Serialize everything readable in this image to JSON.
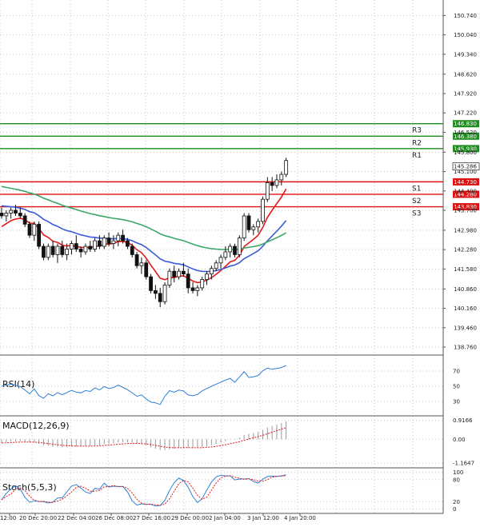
{
  "chart_data": [
    {
      "type": "candlestick",
      "title": "",
      "price_axis": {
        "ylim": [
          138.5,
          151.3
        ],
        "ticks": [
          "150.740",
          "150.040",
          "149.340",
          "148.620",
          "147.920",
          "147.220",
          "146.520",
          "145.800",
          "145.100",
          "144.400",
          "143.700",
          "142.980",
          "142.280",
          "141.580",
          "140.860",
          "140.160",
          "139.460",
          "138.760"
        ]
      },
      "time_axis": {
        "labels": [
          "12:00",
          "20 Dec 20:00",
          "22 Dec 04:00",
          "26 Dec 08:00",
          "27 Dec 16:00",
          "29 Dec 00:00",
          "2 Jan 04:00",
          "3 Jan 12:00",
          "4 Jan 20:00"
        ]
      },
      "current_price": {
        "label": "145.286",
        "value": 145.286
      },
      "levels": [
        {
          "name": "R3",
          "label": "146.830",
          "value": 146.83,
          "color": "#1e8c1e"
        },
        {
          "name": "R2",
          "label": "146.380",
          "value": 146.38,
          "color": "#1e8c1e"
        },
        {
          "name": "R1",
          "label": "145.930",
          "value": 145.93,
          "color": "#1e8c1e"
        },
        {
          "name": "S1",
          "label": "144.730",
          "value": 144.73,
          "color": "#dd1111"
        },
        {
          "name": "S2",
          "label": "144.280",
          "value": 144.28,
          "color": "#dd1111"
        },
        {
          "name": "S3",
          "label": "143.830",
          "value": 143.83,
          "color": "#dd1111"
        }
      ],
      "candles": [
        [
          143.6,
          143.8,
          143.4,
          143.5
        ],
        [
          143.5,
          143.7,
          143.3,
          143.6
        ],
        [
          143.6,
          143.8,
          143.4,
          143.7
        ],
        [
          143.7,
          143.9,
          143.5,
          143.6
        ],
        [
          143.6,
          143.8,
          143.4,
          143.5
        ],
        [
          143.5,
          143.6,
          143.1,
          143.2
        ],
        [
          143.2,
          143.3,
          142.7,
          142.8
        ],
        [
          142.8,
          143.3,
          142.6,
          143.2
        ],
        [
          143.2,
          143.3,
          142.3,
          142.4
        ],
        [
          142.4,
          142.5,
          141.9,
          142.0
        ],
        [
          142.0,
          142.5,
          141.9,
          142.4
        ],
        [
          142.4,
          142.6,
          142.0,
          142.1
        ],
        [
          142.1,
          142.5,
          141.8,
          142.4
        ],
        [
          142.4,
          142.6,
          142.0,
          142.1
        ],
        [
          142.1,
          142.5,
          141.9,
          142.3
        ],
        [
          142.3,
          142.6,
          142.1,
          142.5
        ],
        [
          142.5,
          142.8,
          142.2,
          142.3
        ],
        [
          142.3,
          142.4,
          142.0,
          142.2
        ],
        [
          142.2,
          142.5,
          142.1,
          142.4
        ],
        [
          142.4,
          142.6,
          142.2,
          142.3
        ],
        [
          142.3,
          142.7,
          142.2,
          142.6
        ],
        [
          142.6,
          142.8,
          142.3,
          142.4
        ],
        [
          142.4,
          142.8,
          142.3,
          142.7
        ],
        [
          142.7,
          142.9,
          142.4,
          142.5
        ],
        [
          142.5,
          142.8,
          142.3,
          142.6
        ],
        [
          142.6,
          142.9,
          142.4,
          142.8
        ],
        [
          142.8,
          143.0,
          142.5,
          142.6
        ],
        [
          142.6,
          142.7,
          142.3,
          142.4
        ],
        [
          142.4,
          142.5,
          142.0,
          142.1
        ],
        [
          142.1,
          142.2,
          141.6,
          141.7
        ],
        [
          141.7,
          142.0,
          141.4,
          141.8
        ],
        [
          141.8,
          141.9,
          141.2,
          141.3
        ],
        [
          141.3,
          141.4,
          140.7,
          140.8
        ],
        [
          140.8,
          141.0,
          140.5,
          140.7
        ],
        [
          140.7,
          140.9,
          140.2,
          140.4
        ],
        [
          140.4,
          141.1,
          140.3,
          141.0
        ],
        [
          141.0,
          141.6,
          140.9,
          141.5
        ],
        [
          141.5,
          141.7,
          141.1,
          141.3
        ],
        [
          141.3,
          141.6,
          141.2,
          141.5
        ],
        [
          141.5,
          141.8,
          141.3,
          141.4
        ],
        [
          141.4,
          141.6,
          140.7,
          140.9
        ],
        [
          140.9,
          141.1,
          140.7,
          140.8
        ],
        [
          140.8,
          141.0,
          140.6,
          140.9
        ],
        [
          140.9,
          141.3,
          140.8,
          141.2
        ],
        [
          141.2,
          141.5,
          141.0,
          141.4
        ],
        [
          141.4,
          141.7,
          141.2,
          141.6
        ],
        [
          141.6,
          141.9,
          141.5,
          141.8
        ],
        [
          141.8,
          142.1,
          141.6,
          142.0
        ],
        [
          142.0,
          142.4,
          141.9,
          142.2
        ],
        [
          142.2,
          142.5,
          142.0,
          142.4
        ],
        [
          142.4,
          142.5,
          142.0,
          142.1
        ],
        [
          142.1,
          142.8,
          142.0,
          142.7
        ],
        [
          142.7,
          143.6,
          142.6,
          143.5
        ],
        [
          143.5,
          143.6,
          142.9,
          143.0
        ],
        [
          143.0,
          143.2,
          142.8,
          143.1
        ],
        [
          143.1,
          143.4,
          142.9,
          143.3
        ],
        [
          143.3,
          144.2,
          143.2,
          144.1
        ],
        [
          144.1,
          144.9,
          144.0,
          144.7
        ],
        [
          144.7,
          144.9,
          144.4,
          144.6
        ],
        [
          144.6,
          145.0,
          144.5,
          144.8
        ],
        [
          144.8,
          145.1,
          144.6,
          145.0
        ],
        [
          145.0,
          145.6,
          144.9,
          145.5
        ]
      ],
      "indicators": [
        {
          "name": "MA red",
          "color": "#e31a1c"
        },
        {
          "name": "MA blue",
          "color": "#3a5bd9"
        },
        {
          "name": "MA green",
          "color": "#3aa768"
        }
      ]
    },
    {
      "type": "line",
      "title": "RSI(14)",
      "ticks": [
        "70",
        "50",
        "30"
      ],
      "ylim": [
        12,
        88
      ],
      "series": [
        {
          "color": "#2f7fd8"
        }
      ]
    },
    {
      "type": "bar",
      "title": "MACD(12,26,9)",
      "ticks": [
        "0.9166",
        "0.00",
        "-1.1647"
      ],
      "ylim": [
        -1.35,
        1.1
      ],
      "series": [
        {
          "color": "#999999"
        },
        {
          "color": "#e31a1c"
        }
      ]
    },
    {
      "type": "line",
      "title": "Stoch(5,5,3)",
      "ticks": [
        "100",
        "80",
        "20",
        "0"
      ],
      "ylim": [
        -10,
        110
      ],
      "series": [
        {
          "color": "#2f7fd8"
        },
        {
          "color": "#e31a1c"
        }
      ]
    }
  ]
}
